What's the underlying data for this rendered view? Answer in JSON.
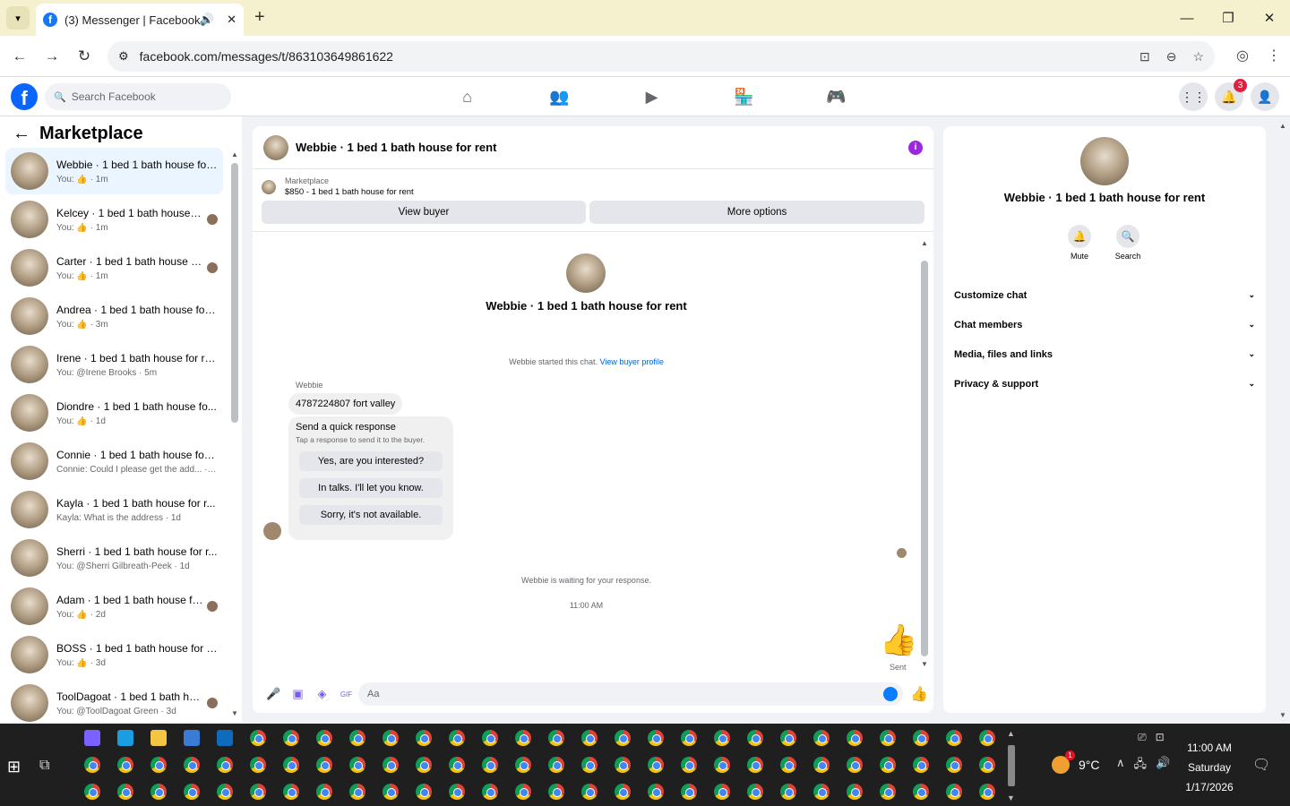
{
  "browser": {
    "tab_title": "(3) Messenger | Facebook",
    "url": "facebook.com/messages/t/863103649861622",
    "new_tab": "+",
    "minimize": "—",
    "restore": "❐",
    "close": "✕"
  },
  "fb": {
    "logo": "f",
    "search_placeholder": "Search Facebook",
    "notifications_count": "3"
  },
  "sidebar": {
    "title": "Marketplace",
    "conversations": [
      {
        "name": "Webbie · 1 bed 1 bath house for...",
        "sub": "You: 👍 · 1m"
      },
      {
        "name": "Kelcey · 1 bed 1 bath house f...",
        "sub": "You: 👍 · 1m"
      },
      {
        "name": "Carter · 1 bed 1 bath house fo...",
        "sub": "You: 👍 · 1m"
      },
      {
        "name": "Andrea · 1 bed 1 bath house for ...",
        "sub": "You: 👍 · 3m"
      },
      {
        "name": "Irene · 1 bed 1 bath house for re...",
        "sub": "You: @Irene Brooks · 5m"
      },
      {
        "name": "Diondre · 1 bed 1 bath house fo...",
        "sub": "You: 👍 · 1d"
      },
      {
        "name": "Connie · 1 bed 1 bath house for ...",
        "sub": "Connie: Could I please get the add... · 1d"
      },
      {
        "name": "Kayla · 1 bed 1 bath house for r...",
        "sub": "Kayla: What is the address · 1d"
      },
      {
        "name": "Sherri · 1 bed 1 bath house for r...",
        "sub": "You: @Sherri Gilbreath-Peek · 1d"
      },
      {
        "name": "Adam · 1 bed 1 bath house fo...",
        "sub": "You: 👍 · 2d"
      },
      {
        "name": "BOSS · 1 bed 1 bath house for r...",
        "sub": "You: 👍 · 3d"
      },
      {
        "name": "ToolDagoat · 1 bed 1 bath ho...",
        "sub": "You: @ToolDagoat Green · 3d"
      }
    ]
  },
  "chat": {
    "header_name": "Webbie · 1 bed 1 bath house for rent",
    "marketplace_label": "Marketplace",
    "listing": "$850 - 1 bed 1 bath house for rent",
    "view_buyer": "View buyer",
    "more_options": "More options",
    "center_name": "Webbie · 1 bed 1 bath house for rent",
    "started_text": "Webbie started this chat.",
    "view_buyer_profile": "View buyer profile",
    "sender": "Webbie",
    "message": "4787224807 fort valley",
    "quick_title": "Send a quick response",
    "quick_sub": "Tap a response to send it to the buyer.",
    "quick_replies": [
      "Yes, are you interested?",
      "In talks. I'll let you know.",
      "Sorry, it's not available."
    ],
    "waiting": "Webbie is waiting for your response.",
    "time": "11:00 AM",
    "sent": "Sent",
    "composer_placeholder": "Aa"
  },
  "rpanel": {
    "name": "Webbie · 1 bed 1 bath house for rent",
    "mute": "Mute",
    "search": "Search",
    "sections": [
      "Customize chat",
      "Chat members",
      "Media, files and links",
      "Privacy & support"
    ]
  },
  "taskbar": {
    "temperature": "9°C",
    "weather_badge": "1",
    "time": "11:00 AM",
    "day": "Saturday",
    "date": "1/17/2026"
  }
}
